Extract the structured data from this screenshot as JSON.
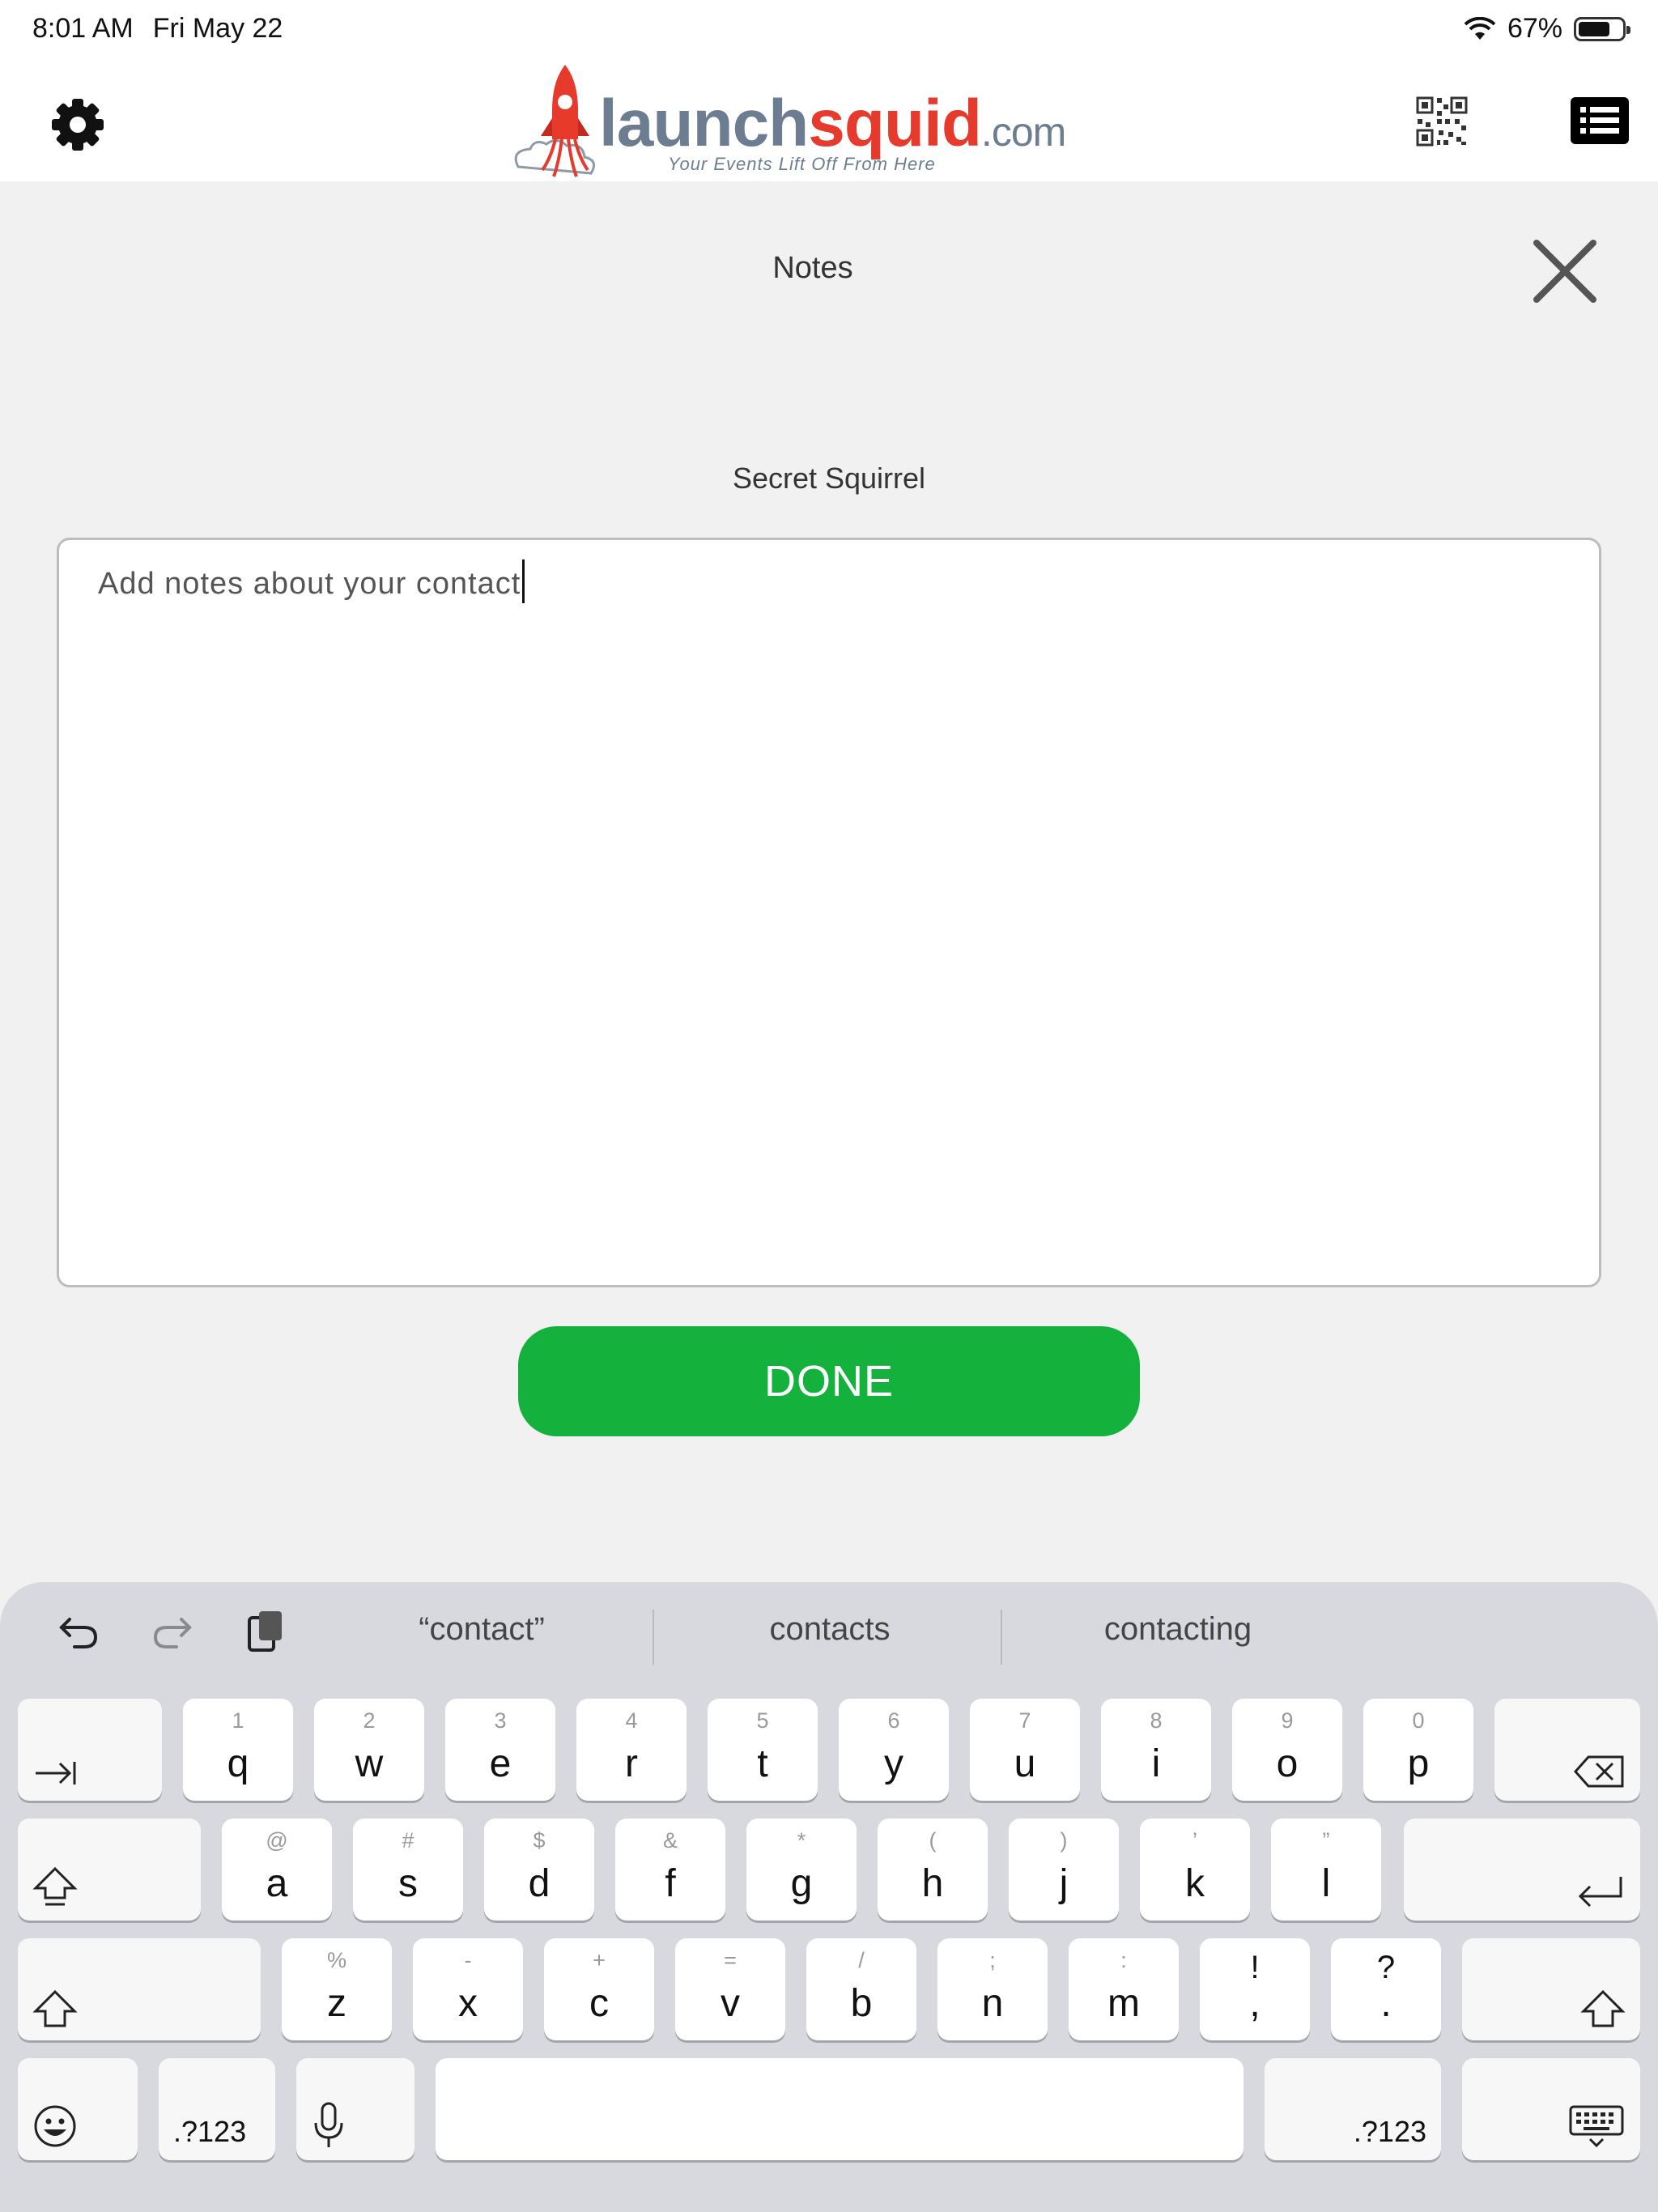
{
  "status_bar": {
    "time": "8:01 AM",
    "date": "Fri May 22",
    "battery": "67%"
  },
  "header": {
    "logo_launch": "launch",
    "logo_squid": "squid",
    "logo_dotcom": ".com",
    "logo_tagline": "Your Events Lift Off   From Here"
  },
  "notes": {
    "title": "Notes",
    "contact_name": "Secret Squirrel",
    "placeholder": "Add notes about your contact",
    "done_label": "DONE"
  },
  "keyboard": {
    "suggestions": [
      "“contact”",
      "contacts",
      "contacting"
    ],
    "row1": [
      {
        "hint": "1",
        "key": "q"
      },
      {
        "hint": "2",
        "key": "w"
      },
      {
        "hint": "3",
        "key": "e"
      },
      {
        "hint": "4",
        "key": "r"
      },
      {
        "hint": "5",
        "key": "t"
      },
      {
        "hint": "6",
        "key": "y"
      },
      {
        "hint": "7",
        "key": "u"
      },
      {
        "hint": "8",
        "key": "i"
      },
      {
        "hint": "9",
        "key": "o"
      },
      {
        "hint": "0",
        "key": "p"
      }
    ],
    "row2": [
      {
        "hint": "@",
        "key": "a"
      },
      {
        "hint": "#",
        "key": "s"
      },
      {
        "hint": "$",
        "key": "d"
      },
      {
        "hint": "&",
        "key": "f"
      },
      {
        "hint": "*",
        "key": "g"
      },
      {
        "hint": "(",
        "key": "h"
      },
      {
        "hint": ")",
        "key": "j"
      },
      {
        "hint": "’",
        "key": "k"
      },
      {
        "hint": "”",
        "key": "l"
      }
    ],
    "row3": [
      {
        "hint": "%",
        "key": "z"
      },
      {
        "hint": "-",
        "key": "x"
      },
      {
        "hint": "+",
        "key": "c"
      },
      {
        "hint": "=",
        "key": "v"
      },
      {
        "hint": "/",
        "key": "b"
      },
      {
        "hint": ";",
        "key": "n"
      },
      {
        "hint": ":",
        "key": "m"
      },
      {
        "hint": "!",
        "key": ","
      },
      {
        "hint": "?",
        "key": "."
      }
    ],
    "numbers_label": ".?123"
  }
}
